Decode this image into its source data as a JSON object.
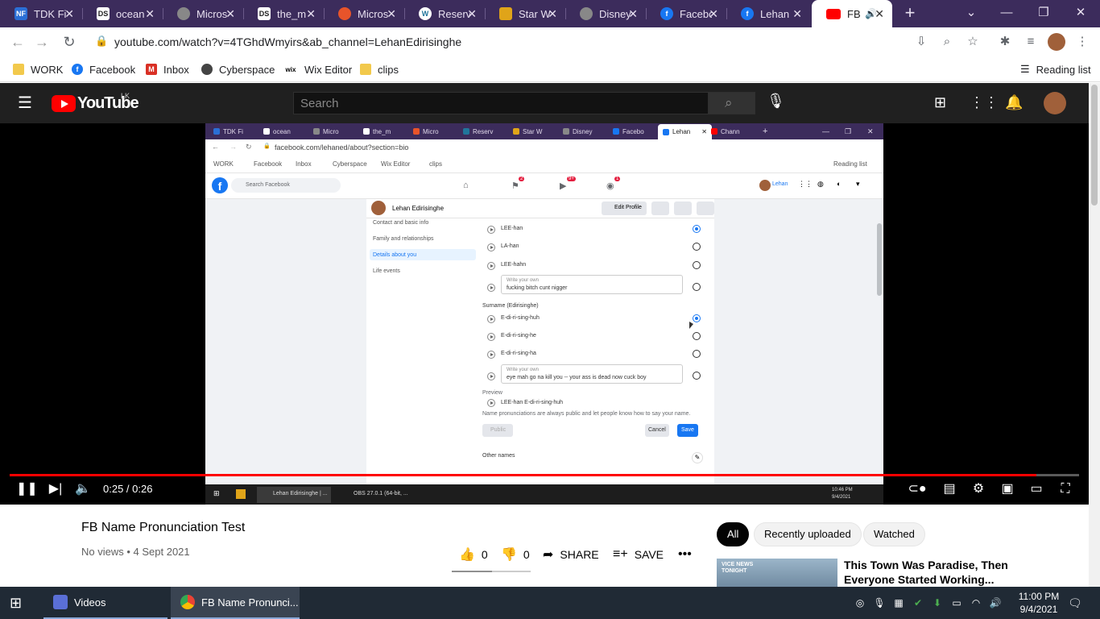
{
  "browser": {
    "tabs": [
      {
        "label": "TDK Fi",
        "icon": "nf-icon",
        "color": "#2b6fd6",
        "glyph": "NF"
      },
      {
        "label": "ocean",
        "icon": "ds-icon",
        "color": "#222222",
        "glyph": "DS"
      },
      {
        "label": "Micros",
        "icon": "globe-icon",
        "color": "#888888",
        "glyph": ""
      },
      {
        "label": "the_m",
        "icon": "ds-icon",
        "color": "#222222",
        "glyph": "DS"
      },
      {
        "label": "Micros",
        "icon": "shield-icon",
        "color": "#e8542a",
        "glyph": ""
      },
      {
        "label": "Reserv",
        "icon": "wordpress-icon",
        "color": "#21759b",
        "glyph": "W"
      },
      {
        "label": "Star W",
        "icon": "bookmark-icon",
        "color": "#e0a419",
        "glyph": ""
      },
      {
        "label": "Disney",
        "icon": "globe-icon",
        "color": "#888888",
        "glyph": ""
      },
      {
        "label": "Facebo",
        "icon": "facebook-icon",
        "color": "#1877f2",
        "glyph": "f"
      },
      {
        "label": "Lehan",
        "icon": "facebook-icon",
        "color": "#1877f2",
        "glyph": "f"
      },
      {
        "label": "FB",
        "icon": "youtube-icon",
        "color": "#ff0000",
        "glyph": "",
        "active": true
      }
    ],
    "url": "youtube.com/watch?v=4TGhdWmyirs&ab_channel=LehanEdirisinghe",
    "bookmarks": [
      {
        "label": "WORK",
        "icon": "folder-icon",
        "color": "#f2c94c"
      },
      {
        "label": "Facebook",
        "icon": "facebook-icon",
        "color": "#1877f2"
      },
      {
        "label": "Inbox",
        "icon": "gmail-icon",
        "color": "#d93025"
      },
      {
        "label": "Cyberspace",
        "icon": "cyberspace-icon",
        "color": "#444444"
      },
      {
        "label": "Wix Editor",
        "icon": "wix-icon",
        "color": "#000000"
      },
      {
        "label": "clips",
        "icon": "folder-icon",
        "color": "#f2c94c"
      }
    ],
    "reading_list": "Reading list"
  },
  "youtube": {
    "logo_text": "YouTube",
    "country_code": "LK",
    "search_placeholder": "Search",
    "time_current": "0:25 / 0:26",
    "progress_fraction": 0.96,
    "video_title": "FB Name Pronunciation Test",
    "video_meta": "No views • 4 Sept 2021",
    "likes": "0",
    "dislikes": "0",
    "share_label": "SHARE",
    "save_label": "SAVE",
    "chips": [
      {
        "label": "All",
        "active": true
      },
      {
        "label": "Recently uploaded"
      },
      {
        "label": "Watched"
      }
    ],
    "related_title": "This Town Was Paradise, Then Everyone Started Working...",
    "thumb_badge": "VICE NEWS TONIGHT"
  },
  "inner": {
    "tabs": [
      "TDK Fi",
      "ocean",
      "Micro",
      "the_m",
      "Micro",
      "Reserv",
      "Star W",
      "Disney",
      "Facebo",
      "Lehan",
      "Chann"
    ],
    "url": "facebook.com/lehaned/about?section=bio",
    "bookmarks": [
      "WORK",
      "Facebook",
      "Inbox",
      "Cyberspace",
      "Wix Editor",
      "clips"
    ],
    "reading_list": "Reading list",
    "search_placeholder": "Search Facebook",
    "profile_name": "Lehan Edirisinghe",
    "user_short": "Lehan",
    "edit_profile": "Edit Profile",
    "sidebar_items": [
      "Contact and basic info",
      "Family and relationships",
      "Details about you",
      "Life events"
    ],
    "options_first": [
      "LEE-han",
      "LA-han",
      "LEE-hahn"
    ],
    "write_own_label": "Write your own",
    "write_own_first": "fucking bitch cunt nigger",
    "surname_heading": "Surname (Edirisinghe)",
    "options_surname": [
      "E-di-ri-sing-huh",
      "E-di-ri-sing-he",
      "E-di-ri-sing-ha"
    ],
    "write_own_surname": "eye mah go na kill you -- your ass is dead now cuck boy",
    "preview_heading": "Preview",
    "preview_value": "LEE-han E-di-ri-sing-huh",
    "notice": "Name pronunciations are always public and let people know how to say your name.",
    "public_label": "Public",
    "cancel_label": "Cancel",
    "save_label": "Save",
    "other_names": "Other names",
    "badges": [
      "2",
      "9+",
      "1"
    ],
    "taskbar_apps": [
      "Lehan Edirisinghe | ...",
      "OBS 27.0.1 (64-bit, ..."
    ],
    "clock_time": "10:46 PM",
    "clock_date": "9/4/2021"
  },
  "taskbar": {
    "apps": [
      {
        "label": "Videos",
        "icon": "videos-icon",
        "color": "#5a6fd6"
      },
      {
        "label": "FB Name Pronunci...",
        "icon": "chrome-icon",
        "color": "#34a853",
        "current": true
      }
    ],
    "time": "11:00 PM",
    "date": "9/4/2021"
  }
}
